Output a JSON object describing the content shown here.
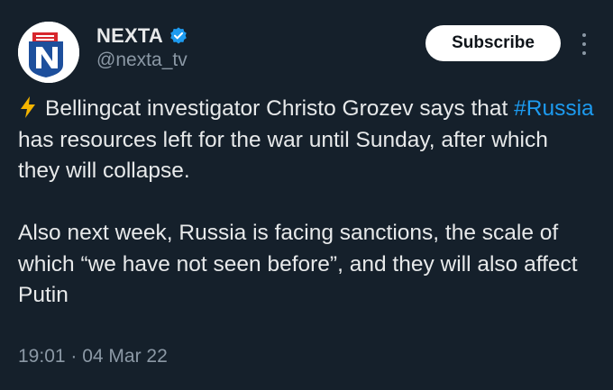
{
  "account": {
    "display_name": "NEXTA",
    "handle": "@nexta_tv",
    "verified": true,
    "avatar_icon": "nexta-logo-icon",
    "avatar_colors": {
      "red": "#d7262c",
      "blue": "#1d4f9c",
      "white": "#ffffff"
    }
  },
  "actions": {
    "subscribe_label": "Subscribe",
    "more_icon": "more-vertical-icon"
  },
  "tweet": {
    "para1_icon": "lightning-bolt-emoji",
    "para1_before": "Bellingcat investigator Christo Grozev says that ",
    "hashtag": "#Russia",
    "para1_after": " has resources left for the war until Sunday, after which they will collapse.",
    "para2": "Also next week, Russia is facing sanctions, the scale of which “we have not seen before”, and they will also affect Putin"
  },
  "meta": {
    "timestamp": "19:01 · 04 Mar 22"
  },
  "colors": {
    "background": "#15202b",
    "text": "#e7e9ea",
    "muted": "#8b98a5",
    "link": "#1d9bf0",
    "verified": "#1d9bf0"
  }
}
